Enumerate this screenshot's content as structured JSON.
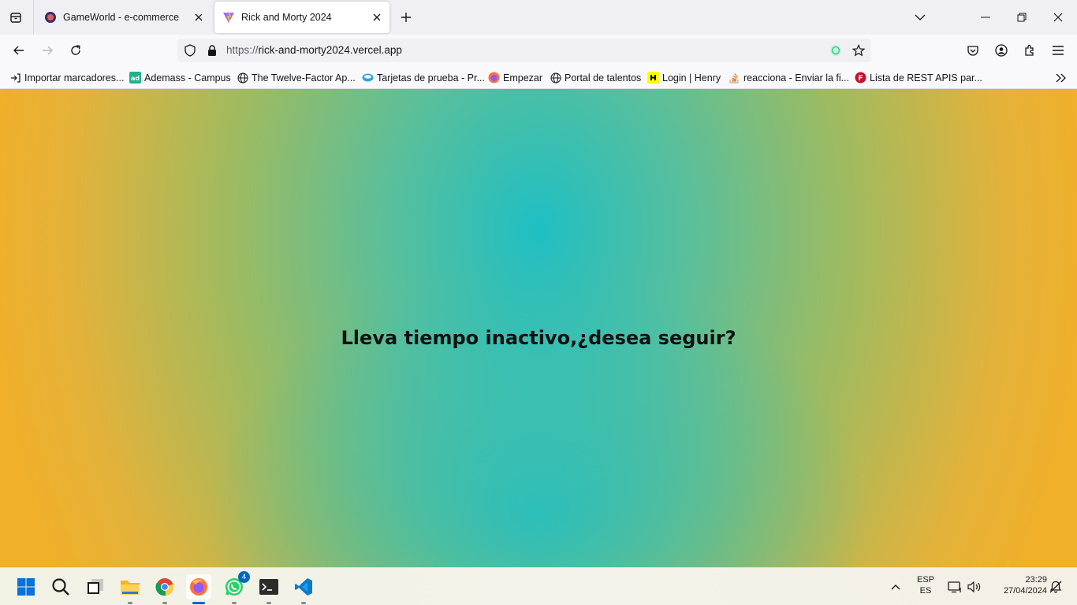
{
  "browser": {
    "tabs": [
      {
        "title": "GameWorld - e-commerce",
        "active": false,
        "favicon": "gameworld-logo-icon"
      },
      {
        "title": "Rick and Morty 2024",
        "active": true,
        "favicon": "vite-logo-icon"
      }
    ],
    "url": {
      "scheme": "https://",
      "host": "rick-and-morty2024.vercel.app"
    },
    "bookmarks": [
      {
        "label": "Importar marcadores...",
        "icon": "import-icon"
      },
      {
        "label": "Ademass - Campus",
        "icon": "ademass-icon"
      },
      {
        "label": "The Twelve-Factor Ap...",
        "icon": "globe-icon"
      },
      {
        "label": "Tarjetas de prueba - Pr...",
        "icon": "cards-icon"
      },
      {
        "label": "Empezar",
        "icon": "firefox-icon"
      },
      {
        "label": "Portal de talentos",
        "icon": "globe-icon"
      },
      {
        "label": "Login | Henry",
        "icon": "henry-icon"
      },
      {
        "label": "reacciona - Enviar la fi...",
        "icon": "stackoverflow-icon"
      },
      {
        "label": "Lista de REST APIS par...",
        "icon": "rest-apis-icon"
      }
    ]
  },
  "page": {
    "idle_message": "Lleva tiempo inactivo,¿desea seguir?"
  },
  "taskbar": {
    "apps": [
      "start-icon",
      "search-icon",
      "task-view-icon",
      "file-explorer-icon",
      "chrome-icon",
      "firefox-icon",
      "whatsapp-icon",
      "terminal-icon",
      "vscode-icon"
    ],
    "whatsapp_badge": "4",
    "language_top": "ESP",
    "language_bottom": "ES",
    "time": "23:29",
    "date": "27/04/2024"
  },
  "colors": {
    "gradient_center": "#1fbfc4",
    "gradient_edge": "#f0b02a"
  }
}
